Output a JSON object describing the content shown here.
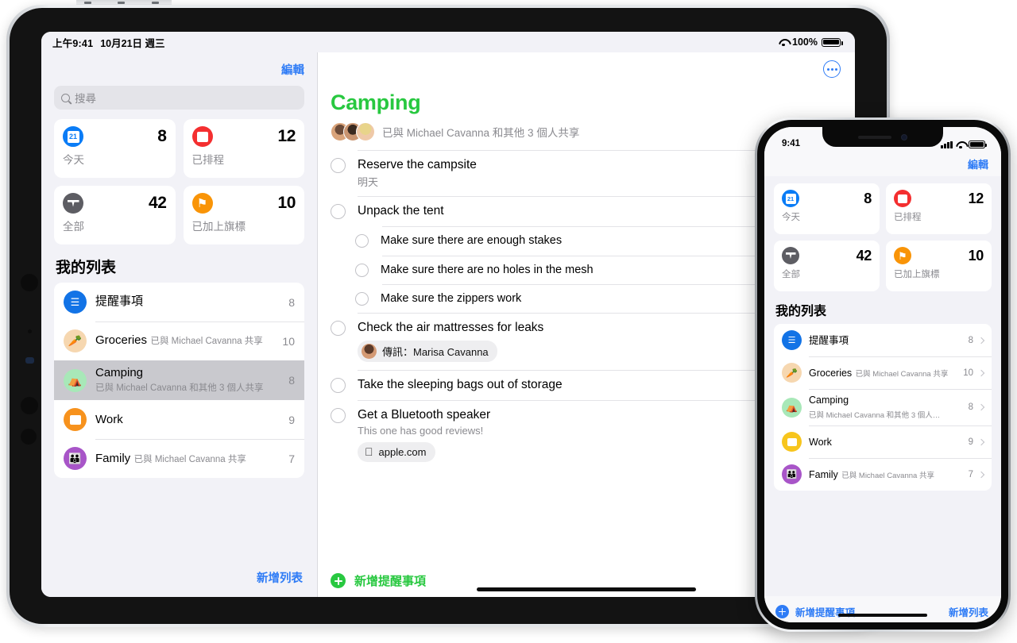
{
  "ipad": {
    "statusbar": {
      "time": "上午9:41",
      "date": "10月21日 週三",
      "battery_pct": "100%"
    },
    "sidebar": {
      "edit_label": "編輯",
      "search_placeholder": "搜尋",
      "smart_lists": [
        {
          "name": "今天",
          "count": "8",
          "icon": "calendar-today-icon",
          "color": "#0a7cf6",
          "glyph": "21"
        },
        {
          "name": "已排程",
          "count": "12",
          "icon": "calendar-scheduled-icon",
          "color": "#f42f30",
          "glyph": "▦"
        },
        {
          "name": "全部",
          "count": "42",
          "icon": "inbox-all-icon",
          "color": "#5d5d63",
          "glyph": "▽"
        },
        {
          "name": "已加上旗標",
          "count": "10",
          "icon": "flag-icon",
          "color": "#f99407",
          "glyph": "⚑"
        }
      ],
      "my_lists_title": "我的列表",
      "lists": [
        {
          "name": "提醒事項",
          "subtitle": "",
          "count": "8",
          "icon": "bullet-list-icon",
          "color": "#1273e6",
          "glyph": "☰",
          "selected": false
        },
        {
          "name": "Groceries",
          "subtitle": "已與 Michael Cavanna 共享",
          "count": "10",
          "icon": "carrot-icon",
          "color": "#f6d7b0",
          "glyph": "🥕",
          "selected": false
        },
        {
          "name": "Camping",
          "subtitle": "已與 Michael Cavanna 和其他 3 個人共享",
          "count": "8",
          "icon": "tent-icon",
          "color": "#a8e8b8",
          "glyph": "⛺",
          "selected": true
        },
        {
          "name": "Work",
          "subtitle": "",
          "count": "9",
          "icon": "computer-icon",
          "color": "#f7921d",
          "glyph": "🖥",
          "selected": false
        },
        {
          "name": "Family",
          "subtitle": "已與 Michael Cavanna 共享",
          "count": "7",
          "icon": "family-icon",
          "color": "#a855c8",
          "glyph": "👪",
          "selected": false
        }
      ],
      "add_list_label": "新增列表"
    },
    "detail": {
      "more_button": "more-options",
      "title": "Camping",
      "title_color": "#28c840",
      "shared_text": "已與 Michael Cavanna 和其他 3 個人共享",
      "reminders": [
        {
          "title": "Reserve the campsite",
          "note": "明天",
          "sub": false,
          "chip": null
        },
        {
          "title": "Unpack the tent",
          "note": "",
          "sub": false,
          "chip": null
        },
        {
          "title": "Make sure there are enough stakes",
          "note": "",
          "sub": true,
          "chip": null
        },
        {
          "title": "Make sure there are no holes in the mesh",
          "note": "",
          "sub": true,
          "chip": null
        },
        {
          "title": "Make sure the zippers work",
          "note": "",
          "sub": true,
          "chip": null
        },
        {
          "title": "Check the air mattresses for leaks",
          "note": "",
          "sub": false,
          "chip": {
            "type": "message",
            "label": "傳訊：Marisa Cavanna"
          }
        },
        {
          "title": "Take the sleeping bags out of storage",
          "note": "",
          "sub": false,
          "chip": null
        },
        {
          "title": "Get a Bluetooth speaker",
          "note": "This one has good reviews!",
          "sub": false,
          "chip": {
            "type": "url",
            "label": "apple.com"
          }
        }
      ],
      "add_reminder_label": "新增提醒事項"
    }
  },
  "iphone": {
    "statusbar": {
      "time": "9:41"
    },
    "edit_label": "編輯",
    "smart_lists": [
      {
        "name": "今天",
        "count": "8",
        "icon": "calendar-today-icon",
        "color": "#0a7cf6",
        "glyph": "21"
      },
      {
        "name": "已排程",
        "count": "12",
        "icon": "calendar-scheduled-icon",
        "color": "#f42f30",
        "glyph": "▦"
      },
      {
        "name": "全部",
        "count": "42",
        "icon": "inbox-all-icon",
        "color": "#5d5d63",
        "glyph": "▽"
      },
      {
        "name": "已加上旗標",
        "count": "10",
        "icon": "flag-icon",
        "color": "#f99407",
        "glyph": "⚑"
      }
    ],
    "my_lists_title": "我的列表",
    "lists": [
      {
        "name": "提醒事項",
        "subtitle": "",
        "count": "8",
        "icon": "bullet-list-icon",
        "color": "#1273e6",
        "glyph": "☰"
      },
      {
        "name": "Groceries",
        "subtitle": "已與 Michael Cavanna 共享",
        "count": "10",
        "icon": "carrot-icon",
        "color": "#f6d7b0",
        "glyph": "🥕"
      },
      {
        "name": "Camping",
        "subtitle": "已與 Michael Cavanna 和其他 3 個人…",
        "count": "8",
        "icon": "tent-icon",
        "color": "#a8e8b8",
        "glyph": "⛺"
      },
      {
        "name": "Work",
        "subtitle": "",
        "count": "9",
        "icon": "computer-icon",
        "color": "#f7c51d",
        "glyph": "🖥"
      },
      {
        "name": "Family",
        "subtitle": "已與 Michael Cavanna 共享",
        "count": "7",
        "icon": "family-icon",
        "color": "#a855c8",
        "glyph": "👪"
      }
    ],
    "add_reminder_label": "新增提醒事項",
    "add_list_label": "新增列表"
  }
}
